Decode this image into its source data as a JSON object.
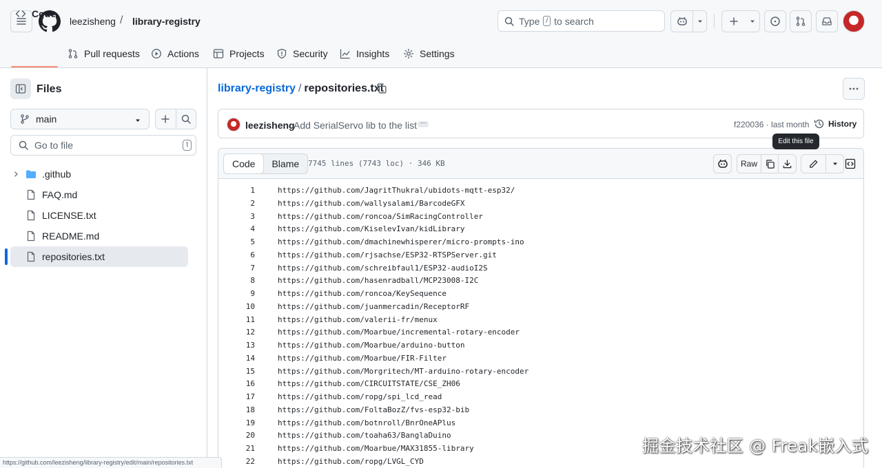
{
  "header": {
    "owner": "leezisheng",
    "separator": "/",
    "repo": "library-registry",
    "search_prefix": "Type",
    "search_key": "/",
    "search_suffix": "to search"
  },
  "tabs": [
    {
      "label": "Code"
    },
    {
      "label": "Pull requests"
    },
    {
      "label": "Actions"
    },
    {
      "label": "Projects"
    },
    {
      "label": "Security"
    },
    {
      "label": "Insights"
    },
    {
      "label": "Settings"
    }
  ],
  "sidebar": {
    "title": "Files",
    "branch": "main",
    "goto_placeholder": "Go to file",
    "goto_key": "t",
    "items": [
      {
        "label": ".github",
        "type": "folder"
      },
      {
        "label": "FAQ.md",
        "type": "file"
      },
      {
        "label": "LICENSE.txt",
        "type": "file"
      },
      {
        "label": "README.md",
        "type": "file"
      },
      {
        "label": "repositories.txt",
        "type": "file"
      }
    ]
  },
  "breadcrumb": {
    "repo": "library-registry",
    "separator": "/",
    "file": "repositories.txt"
  },
  "commit": {
    "author": "leezisheng",
    "message": "Add SerialServo lib to the list",
    "dots": "···",
    "hash_time": "f220036 · last month",
    "history": "History"
  },
  "tooltip": "Edit this file",
  "file": {
    "view_code": "Code",
    "view_blame": "Blame",
    "meta": "7745 lines (7743 loc) · 346 KB",
    "raw": "Raw",
    "lines": [
      {
        "n": "1",
        "t": "https://github.com/JagritThukral/ubidots-mqtt-esp32/"
      },
      {
        "n": "2",
        "t": "https://github.com/wallysalami/BarcodeGFX"
      },
      {
        "n": "3",
        "t": "https://github.com/roncoa/SimRacingController"
      },
      {
        "n": "4",
        "t": "https://github.com/KiselevIvan/kidLibrary"
      },
      {
        "n": "5",
        "t": "https://github.com/dmachinewhisperer/micro-prompts-ino"
      },
      {
        "n": "6",
        "t": "https://github.com/rjsachse/ESP32-RTSPServer.git"
      },
      {
        "n": "7",
        "t": "https://github.com/schreibfaul1/ESP32-audioI2S"
      },
      {
        "n": "8",
        "t": "https://github.com/hasenradball/MCP23008-I2C"
      },
      {
        "n": "9",
        "t": "https://github.com/roncoa/KeySequence"
      },
      {
        "n": "10",
        "t": "https://github.com/juanmercadin/ReceptorRF"
      },
      {
        "n": "11",
        "t": "https://github.com/valerii-fr/menux"
      },
      {
        "n": "12",
        "t": "https://github.com/Moarbue/incremental-rotary-encoder"
      },
      {
        "n": "13",
        "t": "https://github.com/Moarbue/arduino-button"
      },
      {
        "n": "14",
        "t": "https://github.com/Moarbue/FIR-Filter"
      },
      {
        "n": "15",
        "t": "https://github.com/Morgritech/MT-arduino-rotary-encoder"
      },
      {
        "n": "16",
        "t": "https://github.com/CIRCUITSTATE/CSE_ZH06"
      },
      {
        "n": "17",
        "t": "https://github.com/ropg/spi_lcd_read"
      },
      {
        "n": "18",
        "t": "https://github.com/FoltaBozZ/fvs-esp32-bib"
      },
      {
        "n": "19",
        "t": "https://github.com/botnroll/BnrOneAPlus"
      },
      {
        "n": "20",
        "t": "https://github.com/toaha63/BanglaDuino"
      },
      {
        "n": "21",
        "t": "https://github.com/Moarbue/MAX31855-library"
      },
      {
        "n": "22",
        "t": "https://github.com/ropg/LVGL_CYD"
      }
    ]
  },
  "status_url": "https://github.com/leezisheng/library-registry/edit/main/repositories.txt",
  "watermark": "掘金技术社区 @ Freak嵌入式"
}
